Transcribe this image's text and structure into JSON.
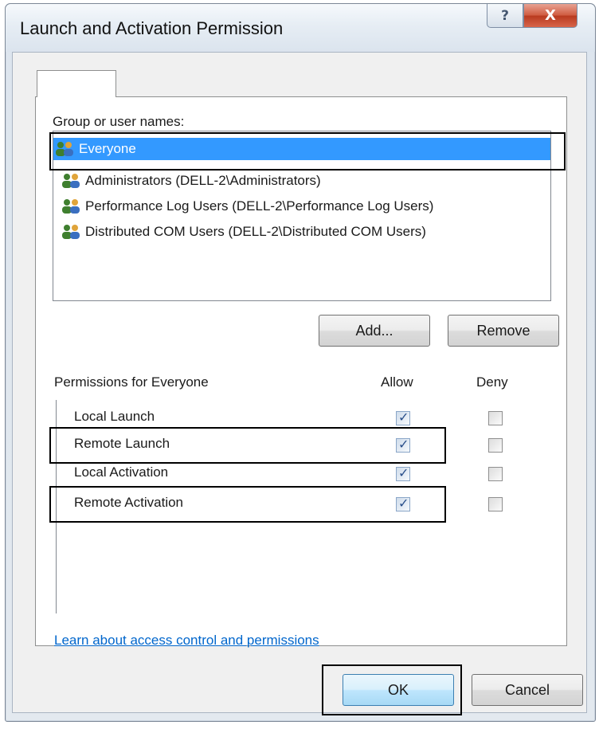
{
  "window": {
    "title": "Launch and Activation Permission",
    "help_glyph": "?",
    "close_glyph": "X"
  },
  "tab": {
    "label": ""
  },
  "users": {
    "heading": "Group or user names:",
    "items": [
      {
        "name": "Everyone",
        "selected": true
      },
      {
        "name": "Administrators (DELL-2\\Administrators)",
        "selected": false
      },
      {
        "name": "Performance Log Users (DELL-2\\Performance Log Users)",
        "selected": false
      },
      {
        "name": "Distributed COM Users (DELL-2\\Distributed COM Users)",
        "selected": false
      }
    ],
    "icon": "users-group-icon"
  },
  "buttons": {
    "add": "Add...",
    "remove": "Remove",
    "ok": "OK",
    "cancel": "Cancel"
  },
  "permissions": {
    "heading": "Permissions for Everyone",
    "allow_header": "Allow",
    "deny_header": "Deny",
    "rows": [
      {
        "name": "Local Launch",
        "allow": true,
        "deny": false
      },
      {
        "name": "Remote Launch",
        "allow": true,
        "deny": false
      },
      {
        "name": "Local Activation",
        "allow": true,
        "deny": false
      },
      {
        "name": "Remote Activation",
        "allow": true,
        "deny": false
      }
    ]
  },
  "link": {
    "text": "Learn about access control and permissions"
  },
  "colors": {
    "selection": "#3399ff",
    "link": "#0066cc",
    "close": "#c7472b"
  }
}
